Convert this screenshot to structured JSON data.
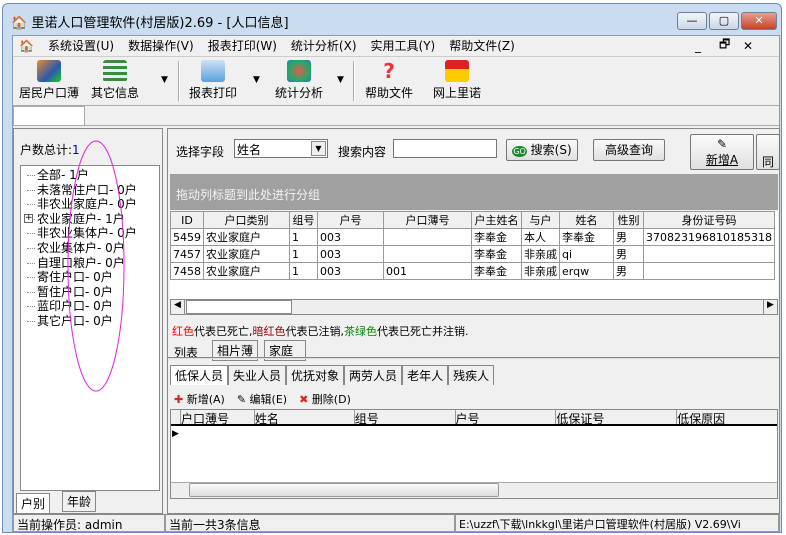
{
  "window": {
    "title": "里诺人口管理软件(村居版)2.69 - [人口信息]",
    "min": "—",
    "max": "▢",
    "close": "✕"
  },
  "menu": [
    "系统设置(U)",
    "数据操作(V)",
    "报表打印(W)",
    "统计分析(X)",
    "实用工具(Y)",
    "帮助文件(Z)"
  ],
  "mdi": {
    "min": "_",
    "restore": "🗗",
    "close": "✕"
  },
  "toolbar": [
    "居民户口薄",
    "其它信息",
    "报表打印",
    "统计分析",
    "帮助文件",
    "网上里诺"
  ],
  "left": {
    "total_label": "户数总计:",
    "total_value": "1",
    "tree": [
      "全部- 1户",
      "未落常住户口- 0户",
      "非农业家庭户- 0户",
      "农业家庭户- 1户",
      "非农业集体户- 0户",
      "农业集体户- 0户",
      "自理口粮户- 0户",
      "寄住户口- 0户",
      "暂住户口- 0户",
      "蓝印户口- 0户",
      "其它户口- 0户"
    ],
    "tabs": [
      "户别",
      "年龄"
    ]
  },
  "search": {
    "field_label": "选择字段",
    "field_value": "姓名",
    "content_label": "搜索内容",
    "content_value": "",
    "search_btn": "搜索(S)",
    "advanced_btn": "高级查询",
    "add_btn": "新增A",
    "same_btn": "同户"
  },
  "group_hint": "拖动列标题到此处进行分组",
  "grid": {
    "columns": [
      "ID",
      "户口类别",
      "组号",
      "户号",
      "户口薄号",
      "户主姓名",
      "与户",
      "姓名",
      "性别",
      "身份证号码"
    ],
    "rows": [
      [
        "5459",
        "农业家庭户",
        "1",
        "003",
        "",
        "李奉金",
        "本人",
        "李奉金",
        "男",
        "370823196810185318"
      ],
      [
        "7457",
        "农业家庭户",
        "1",
        "003",
        "",
        "李奉金",
        "非亲戚",
        "qi",
        "男",
        ""
      ],
      [
        "7458",
        "农业家庭户",
        "1",
        "003",
        "001",
        "李奉金",
        "非亲戚",
        "erqw",
        "男",
        ""
      ]
    ]
  },
  "legend": {
    "red": "红色",
    "t1": "代表已死亡,",
    "darkred": "暗红色",
    "t2": "代表已注销,",
    "teal": "茶绿色",
    "t3": "代表已死亡并注销."
  },
  "colors": {
    "red": "#ff0000",
    "darkred": "#990000",
    "teal": "#008000"
  },
  "view_tabs": [
    "列表",
    "相片薄",
    "家庭"
  ],
  "sub_tabs": [
    "低保人员",
    "失业人员",
    "优抚对象",
    "两劳人员",
    "老年人",
    "残疾人"
  ],
  "sub_actions": [
    "新增(A)",
    "编辑(E)",
    "删除(D)"
  ],
  "sub_columns": [
    "户口薄号",
    "姓名",
    "组号",
    "户号",
    "低保证号",
    "低保原因"
  ],
  "status": {
    "operator": "当前操作员: admin",
    "count": "当前一共3条信息",
    "path": "E:\\uzzf\\下载\\lnkkgl\\里诺户口管理软件(村居版) V2.69\\Vi"
  }
}
